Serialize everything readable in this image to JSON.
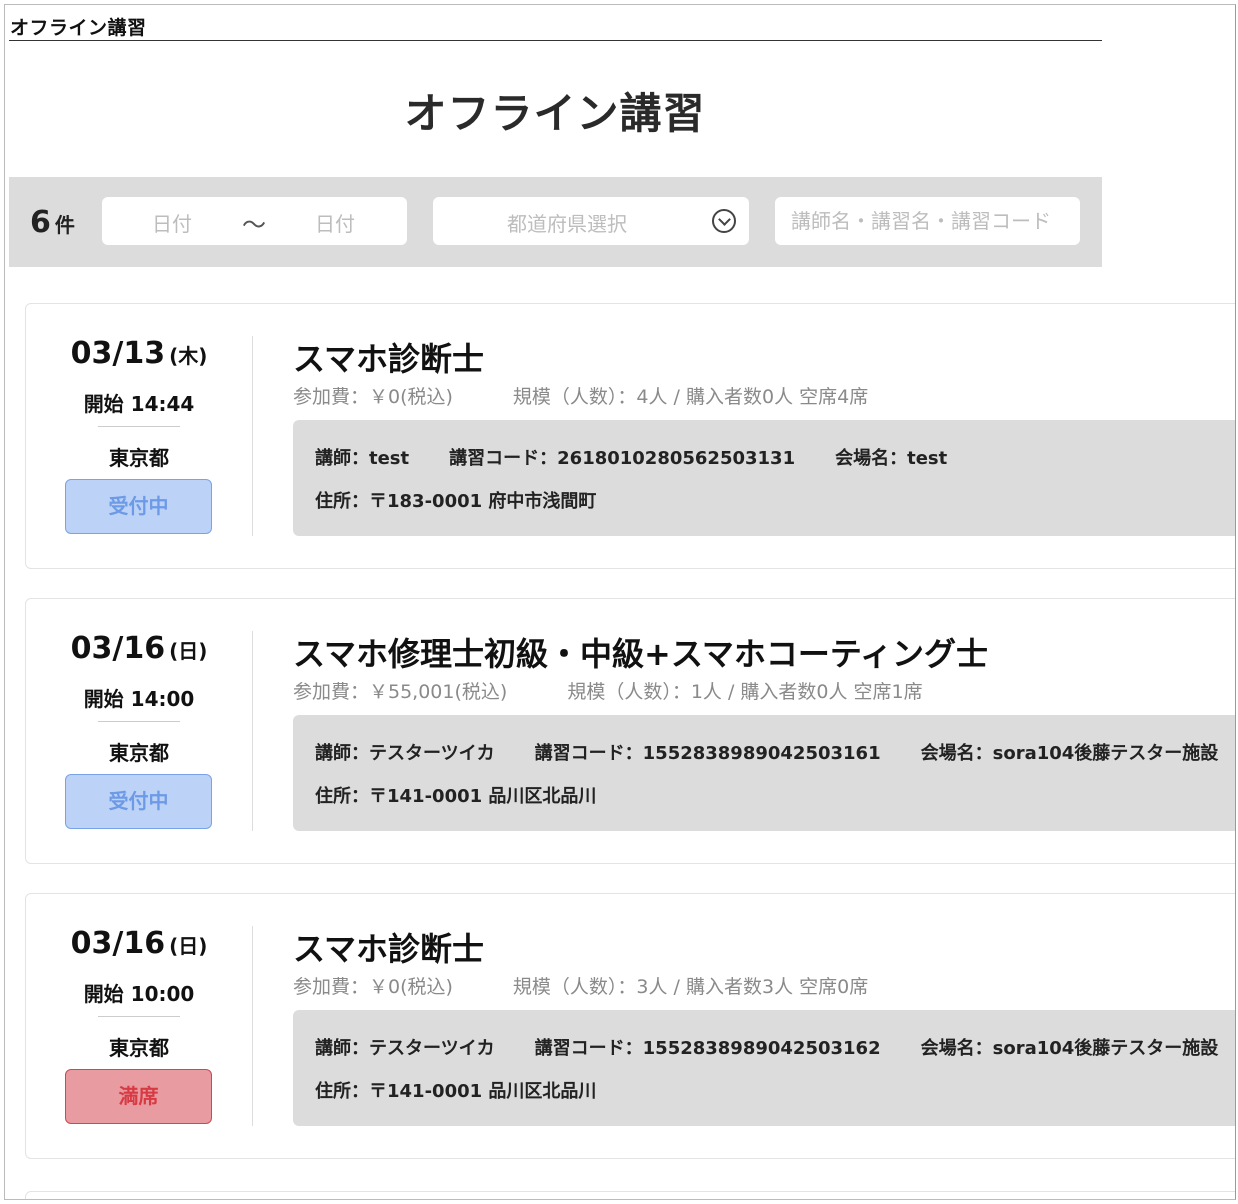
{
  "window": {
    "title": "オフライン講習"
  },
  "page": {
    "title": "オフライン講習"
  },
  "filters": {
    "count": "6",
    "count_unit": "件",
    "date_from_placeholder": "日付",
    "date_separator": "〜",
    "date_to_placeholder": "日付",
    "prefecture_placeholder": "都道府県選択",
    "search_placeholder": "講師名・講習名・講習コード"
  },
  "courses": [
    {
      "date": "03/13",
      "weekday": "(木)",
      "start": "開始 14:44",
      "prefecture": "東京都",
      "status": "受付中",
      "title": "スマホ診断士",
      "fee": "参加費：￥0(税込)",
      "scale": "規模（人数）：4人 / 購入者数0人 空席4席",
      "instructor": "講師：test",
      "code": "講習コード：2618010280562503131",
      "venue": "会場名：test",
      "address": "住所：〒183-0001 府中市浅間町"
    },
    {
      "date": "03/16",
      "weekday": "(日)",
      "start": "開始 14:00",
      "prefecture": "東京都",
      "status": "受付中",
      "title": "スマホ修理士初級・中級+スマホコーティング士",
      "fee": "参加費：￥55,001(税込)",
      "scale": "規模（人数）：1人 / 購入者数0人 空席1席",
      "instructor": "講師：テスターツイカ",
      "code": "講習コード：1552838989042503161",
      "venue": "会場名：sora104後藤テスター施設",
      "address": "住所：〒141-0001 品川区北品川"
    },
    {
      "date": "03/16",
      "weekday": "(日)",
      "start": "開始 10:00",
      "prefecture": "東京都",
      "status": "満席",
      "title": "スマホ診断士",
      "fee": "参加費：￥0(税込)",
      "scale": "規模（人数）：3人 / 購入者数3人 空席0席",
      "instructor": "講師：テスターツイカ",
      "code": "講習コード：1552838989042503162",
      "venue": "会場名：sora104後藤テスター施設",
      "address": "住所：〒141-0001 品川区北品川"
    }
  ],
  "colors": {
    "status_open_bg": "#bcd3f7",
    "status_open_text": "#6d9ae6",
    "status_full_bg": "#e89ba0",
    "status_full_text": "#d83a44",
    "filter_bar_bg": "#dcdcdc"
  }
}
